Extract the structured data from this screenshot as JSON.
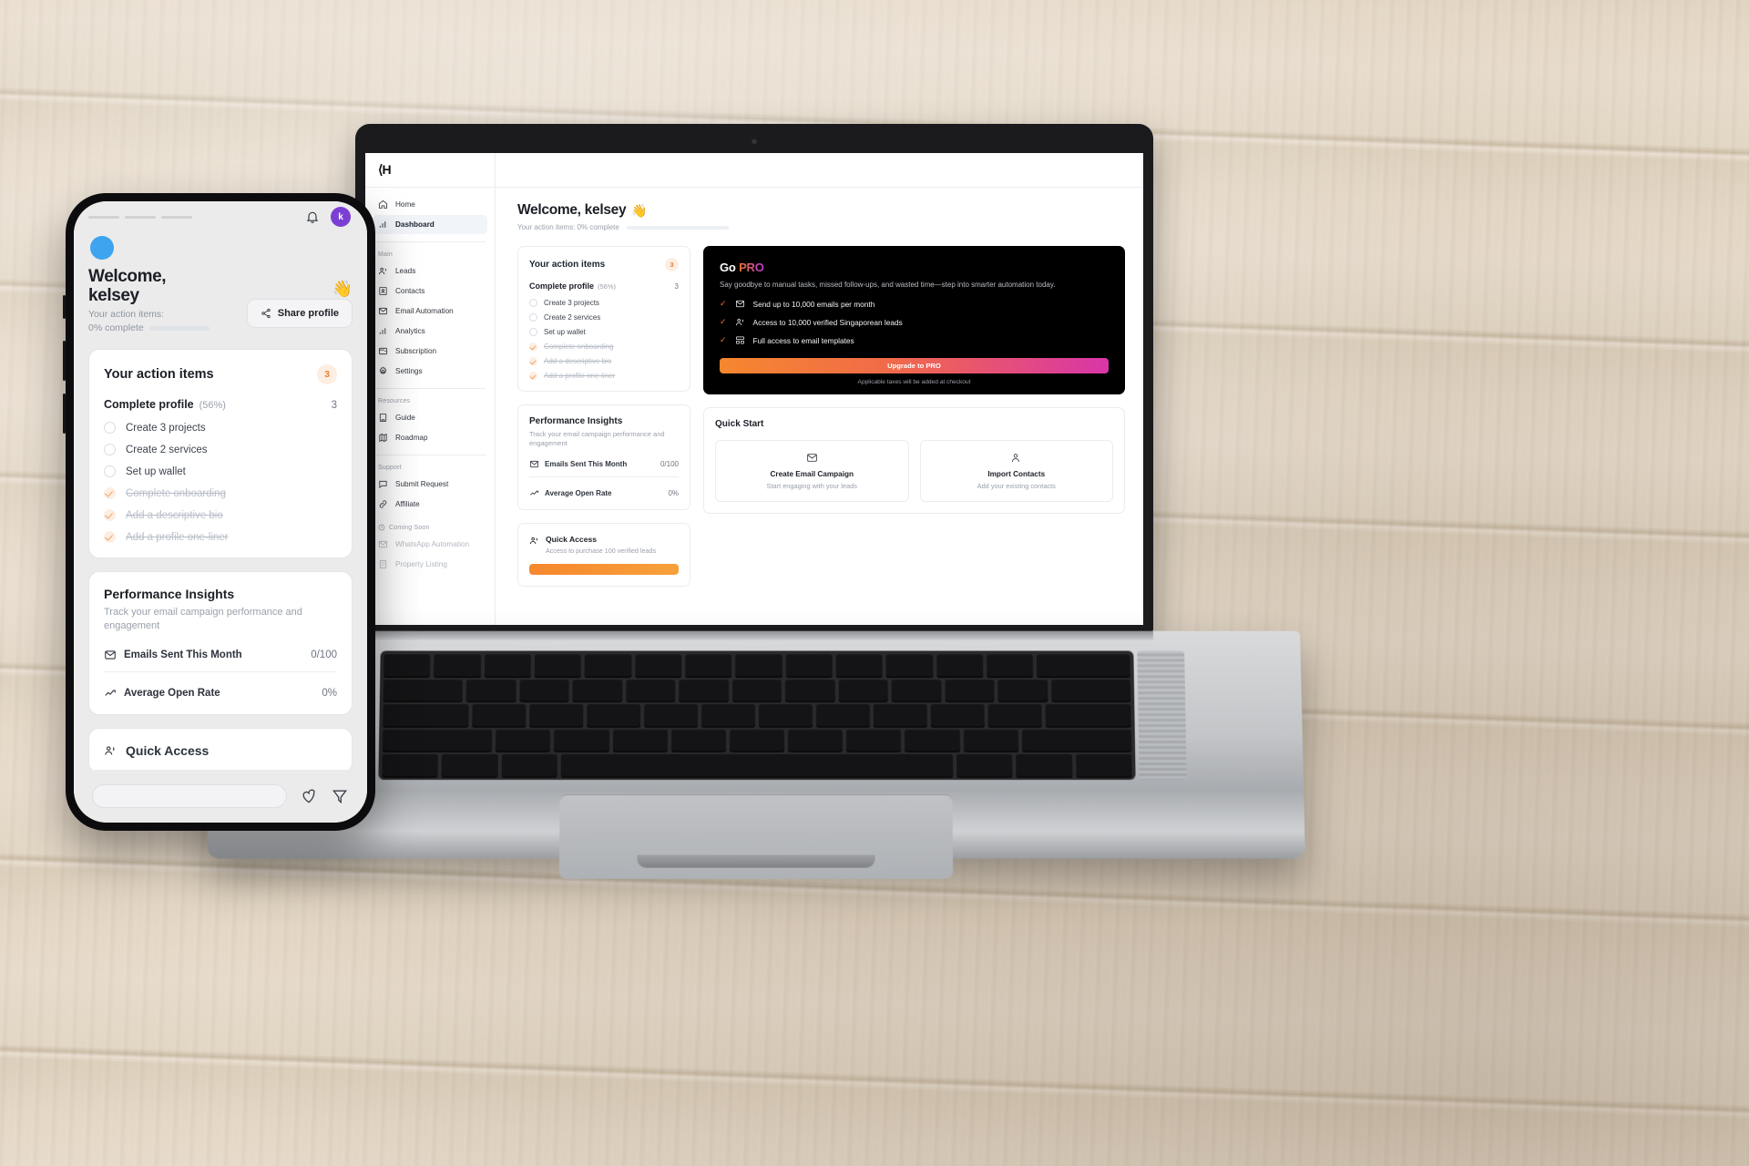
{
  "laptop": {
    "sidebar": {
      "brand": "⟨H",
      "top_items": [
        {
          "label": "Home",
          "icon": "home-icon",
          "active": false
        },
        {
          "label": "Dashboard",
          "icon": "bar-chart-icon",
          "active": true
        }
      ],
      "groups": [
        {
          "label": "Main",
          "items": [
            {
              "label": "Leads",
              "icon": "users-icon"
            },
            {
              "label": "Contacts",
              "icon": "contact-card-icon"
            },
            {
              "label": "Email Automation",
              "icon": "mail-icon"
            },
            {
              "label": "Analytics",
              "icon": "bar-chart-icon"
            },
            {
              "label": "Subscription",
              "icon": "wallet-icon"
            },
            {
              "label": "Settings",
              "icon": "gear-icon"
            }
          ]
        },
        {
          "label": "Resources",
          "items": [
            {
              "label": "Guide",
              "icon": "book-icon"
            },
            {
              "label": "Roadmap",
              "icon": "map-icon"
            }
          ]
        },
        {
          "label": "Support",
          "items": [
            {
              "label": "Submit Request",
              "icon": "message-icon"
            },
            {
              "label": "Affiliate",
              "icon": "link-icon"
            }
          ]
        },
        {
          "label": "Coming Soon",
          "icon": "clock-icon",
          "muted": true,
          "items": [
            {
              "label": "WhatsApp Automation",
              "icon": "mail-icon"
            },
            {
              "label": "Property Listing",
              "icon": "building-icon"
            }
          ]
        }
      ]
    },
    "welcome": {
      "title": "Welcome, kelsey",
      "wave_emoji": "👋",
      "progress_text": "Your action items: 0% complete",
      "progress_percent": 0
    },
    "action_items": {
      "title": "Your action items",
      "badge": "3",
      "section_title": "Complete profile",
      "section_percent": "(56%)",
      "section_count": "3",
      "items": [
        {
          "label": "Create 3 projects",
          "done": false
        },
        {
          "label": "Create 2 services",
          "done": false
        },
        {
          "label": "Set up wallet",
          "done": false
        },
        {
          "label": "Complete onboarding",
          "done": true
        },
        {
          "label": "Add a descriptive bio",
          "done": true
        },
        {
          "label": "Add a profile one-liner",
          "done": true
        }
      ]
    },
    "performance_insights": {
      "title": "Performance Insights",
      "subtitle": "Track your email campaign performance and engagement",
      "metrics": [
        {
          "label": "Emails Sent This Month",
          "value": "0/100",
          "icon": "mail-icon"
        },
        {
          "label": "Average Open Rate",
          "value": "0%",
          "icon": "trend-up-icon"
        }
      ]
    },
    "quick_access": {
      "title": "Quick Access",
      "subtitle": "Access to purchase 100 verified leads",
      "icon": "users-icon"
    },
    "pro": {
      "title_prefix": "Go ",
      "title_accent": "PRO",
      "subtitle": "Say goodbye to manual tasks, missed follow-ups, and wasted time—step into smarter automation today.",
      "features": [
        {
          "label": "Send up to 10,000 emails per month",
          "icon": "mail-icon"
        },
        {
          "label": "Access to 10,000 verified Singaporean leads",
          "icon": "users-icon"
        },
        {
          "label": "Full access to email templates",
          "icon": "template-icon"
        }
      ],
      "cta": "Upgrade to PRO",
      "note": "Applicable taxes will be added at checkout"
    },
    "quick_start": {
      "title": "Quick Start",
      "cards": [
        {
          "name": "Create Email Campaign",
          "desc": "Start engaging with your leads",
          "icon": "mail-icon"
        },
        {
          "name": "Import Contacts",
          "desc": "Add your existing contacts",
          "icon": "user-add-icon"
        }
      ]
    }
  },
  "phone": {
    "avatar_initial": "k",
    "welcome_line1": "Welcome,",
    "welcome_line2": "kelsey",
    "wave_emoji": "👋",
    "share_label": "Share profile",
    "progress_line1": "Your action items:",
    "progress_line2": "0% complete",
    "action_items": {
      "title": "Your action items",
      "badge": "3",
      "section_title": "Complete profile",
      "section_percent": "(56%)",
      "section_count": "3",
      "items": [
        {
          "label": "Create 3 projects",
          "done": false
        },
        {
          "label": "Create 2 services",
          "done": false
        },
        {
          "label": "Set up wallet",
          "done": false
        },
        {
          "label": "Complete onboarding",
          "done": true
        },
        {
          "label": "Add a descriptive bio",
          "done": true
        },
        {
          "label": "Add a profile one-liner",
          "done": true
        }
      ]
    },
    "performance_insights": {
      "title": "Performance Insights",
      "subtitle": "Track your email campaign performance and engagement",
      "metrics": [
        {
          "label": "Emails Sent This Month",
          "value": "0/100",
          "icon": "mail-icon"
        },
        {
          "label": "Average Open Rate",
          "value": "0%",
          "icon": "trend-up-icon"
        }
      ]
    },
    "quick_access_title": "Quick Access"
  },
  "colors": {
    "accent_orange": "#f6872e",
    "accent_magenta": "#d935a8",
    "badge_bg": "#fdeee2",
    "avatar_purple": "#7b3fd4",
    "pro_bg": "#000000"
  }
}
